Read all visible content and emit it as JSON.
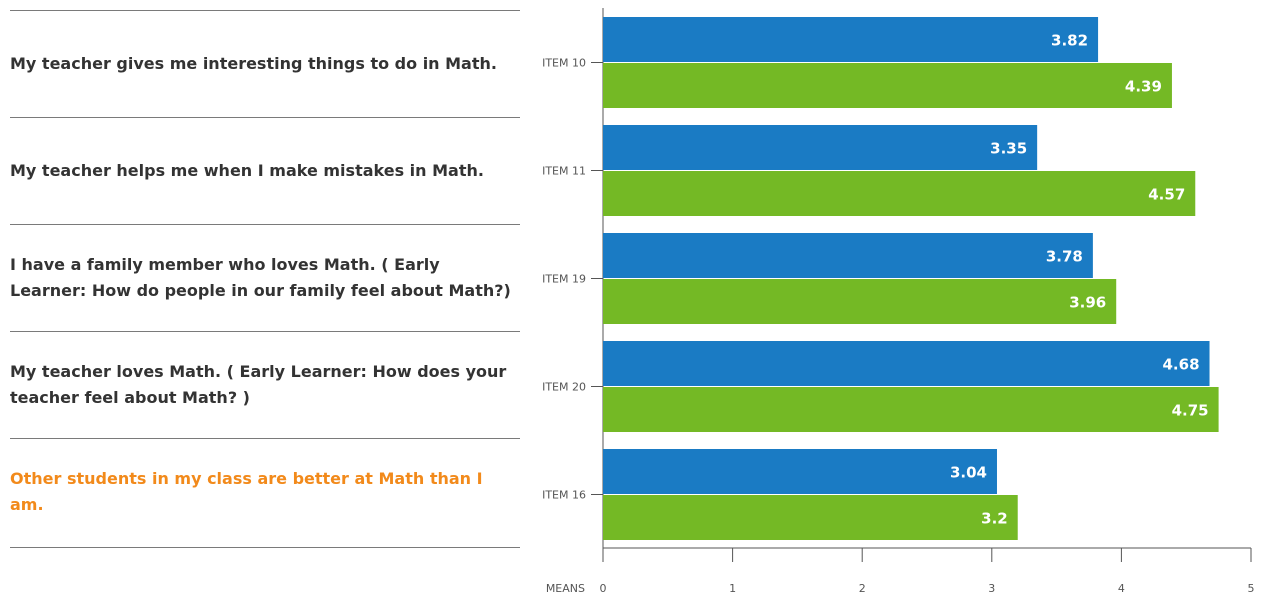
{
  "statements": [
    {
      "text": "My teacher gives me interesting things to do in Math.",
      "highlight": false
    },
    {
      "text": "My teacher helps me when I make mistakes in Math.",
      "highlight": false
    },
    {
      "text": "I have a family member who loves Math. ( Early Learner: How do people in our family feel about Math?)",
      "highlight": false
    },
    {
      "text": "My teacher loves Math. ( Early Learner: How does your teacher feel about Math? )",
      "highlight": false
    },
    {
      "text": "Other students in my class are better at Math than I am.",
      "highlight": true
    }
  ],
  "chart_data": {
    "type": "bar",
    "orientation": "horizontal",
    "categories": [
      "ITEM 10",
      "ITEM 11",
      "ITEM 19",
      "ITEM 20",
      "ITEM 16"
    ],
    "series": [
      {
        "values": [
          3.82,
          3.35,
          3.78,
          4.68,
          3.04
        ],
        "color": "#1a7bc4"
      },
      {
        "values": [
          4.39,
          4.57,
          3.96,
          4.75,
          3.2
        ],
        "color": "#74b925"
      }
    ],
    "xlabel": "MEANS",
    "xlim": [
      0,
      5
    ],
    "xticks": [
      0,
      1,
      2,
      3,
      4,
      5
    ],
    "grid": false,
    "data_labels": true
  },
  "colors": {
    "highlight_text": "#f28a1b",
    "axis": "#555555",
    "label_text": "#ffffff"
  }
}
